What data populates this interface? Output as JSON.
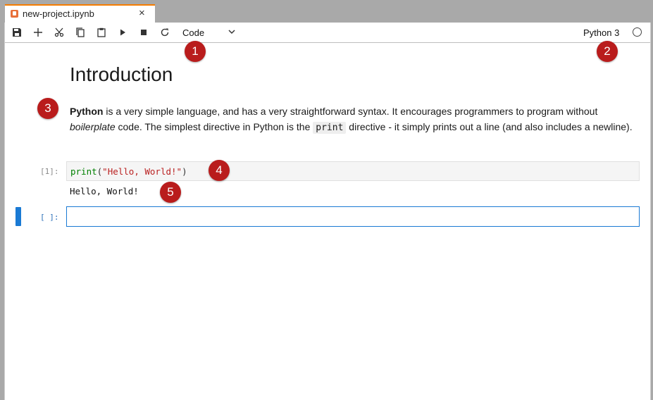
{
  "tab": {
    "title": "new-project.ipynb",
    "close_icon": "×"
  },
  "toolbar": {
    "buttons": [
      "save-icon",
      "add-icon",
      "cut-icon",
      "copy-icon",
      "paste-icon",
      "run-icon",
      "stop-icon",
      "restart-icon"
    ],
    "cell_type": "Code",
    "kernel_name": "Python 3"
  },
  "notebook": {
    "heading": "Introduction",
    "paragraph": {
      "bold_word": "Python",
      "text_1": " is a very simple language, and has a very straightforward syntax. It encourages programmers to program without ",
      "italic_word": "boilerplate",
      "text_2": " code. The simplest directive in Python is the ",
      "code_word": "print",
      "text_3": " directive - it simply prints out a line (and also includes a newline)."
    },
    "code_cell": {
      "prompt": "[1]:",
      "func": "print",
      "open_paren": "(",
      "string": "\"Hello, World!\"",
      "close_paren": ")",
      "output": "Hello, World!"
    },
    "empty_cell": {
      "prompt": "[ ]:"
    }
  },
  "callouts": [
    "1",
    "2",
    "3",
    "4",
    "5"
  ],
  "colors": {
    "accent": "#1a7ad4",
    "callout": "#b91c1c",
    "tab_border": "#f57c00"
  }
}
